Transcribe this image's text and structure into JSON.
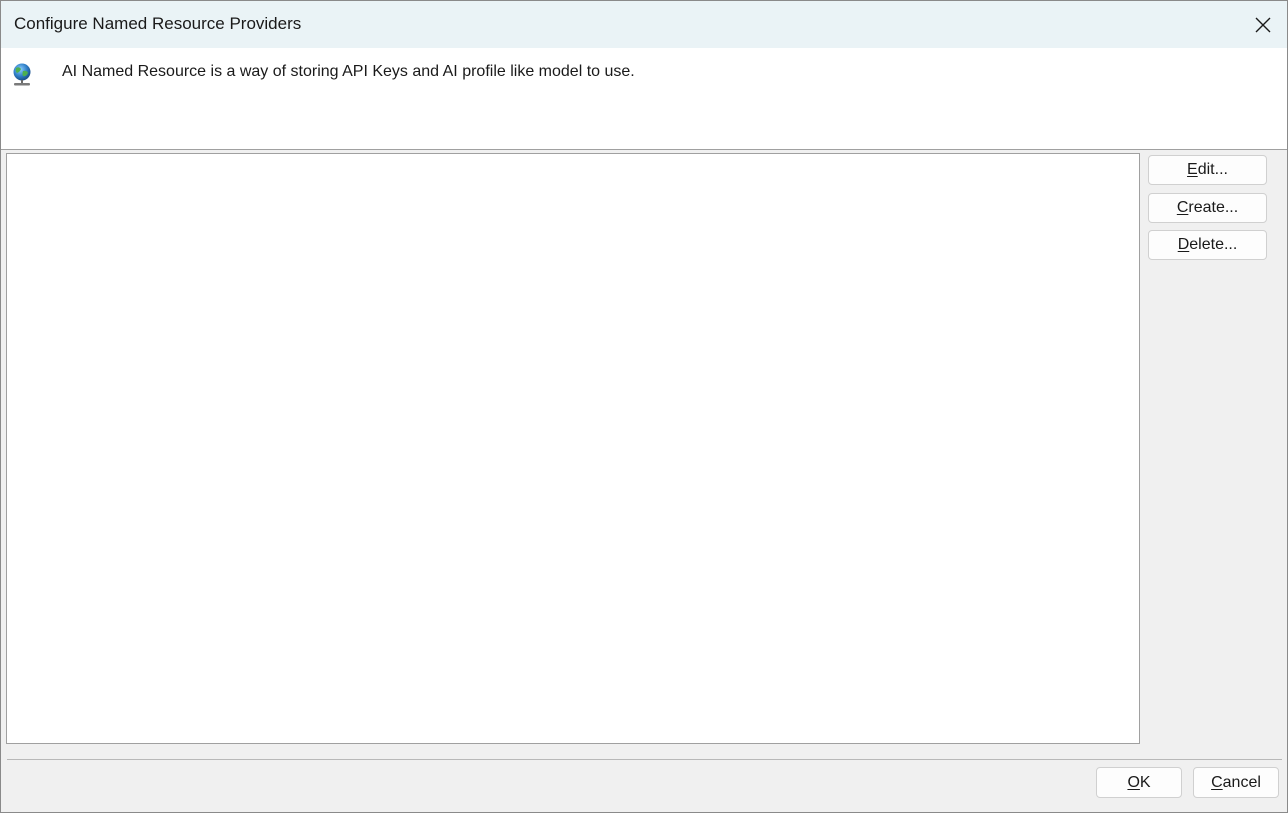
{
  "window": {
    "title": "Configure Named Resource Providers",
    "close_icon": "close-icon"
  },
  "header": {
    "icon": "globe-network-icon",
    "description": "AI Named Resource is a way of storing API Keys and AI profile like model to use."
  },
  "providers_list": {
    "items": []
  },
  "side_buttons": {
    "edit": {
      "mnemonic": "E",
      "rest": "dit..."
    },
    "create": {
      "mnemonic": "C",
      "rest": "reate..."
    },
    "delete": {
      "mnemonic": "D",
      "rest": "elete..."
    }
  },
  "footer": {
    "ok": {
      "mnemonic": "O",
      "rest": "K"
    },
    "cancel": {
      "mnemonic": "C",
      "rest": "ancel"
    }
  },
  "colors": {
    "titlebar_bg": "#eaf3f6",
    "dialog_bg": "#f0f0f0",
    "panel_bg": "#ffffff",
    "border": "#a0a0a0"
  }
}
